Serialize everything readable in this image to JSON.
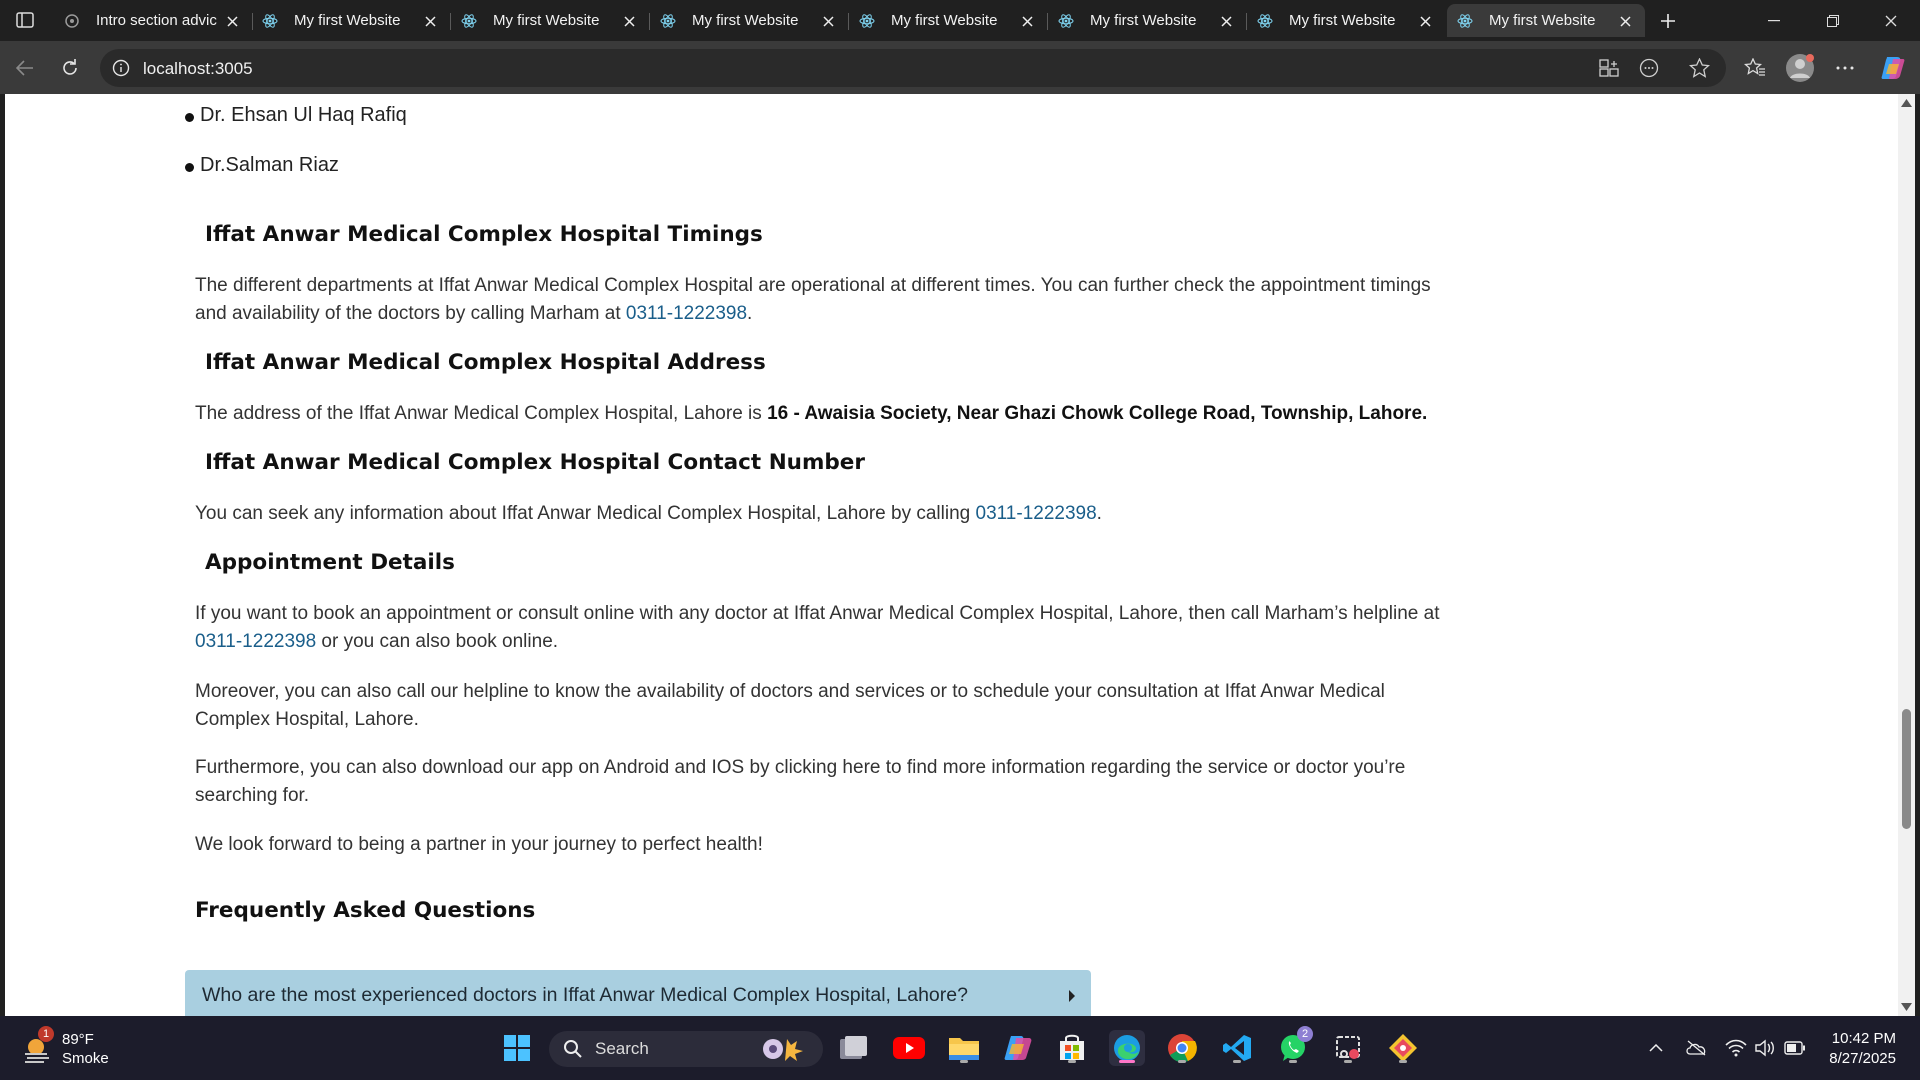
{
  "browser": {
    "tabs": [
      {
        "title": "Intro section advic",
        "active": false
      },
      {
        "title": "My first Website",
        "active": false
      },
      {
        "title": "My first Website",
        "active": false
      },
      {
        "title": "My first Website",
        "active": false
      },
      {
        "title": "My first Website",
        "active": false
      },
      {
        "title": "My first Website",
        "active": false
      },
      {
        "title": "My first Website",
        "active": false
      },
      {
        "title": "My first Website",
        "active": true
      }
    ],
    "url": "localhost:3005"
  },
  "page": {
    "doctors": [
      "Dr. Ehsan Ul Haq Rafiq",
      "Dr.Salman Riaz"
    ],
    "timings": {
      "heading": "Iffat Anwar Medical Complex Hospital Timings",
      "text": "The different departments at Iffat Anwar Medical Complex Hospital are operational at different times. You can further check the appointment timings and availability of the doctors by calling Marham at ",
      "phone": "0311-1222398",
      "end": "."
    },
    "address": {
      "heading": "Iffat Anwar Medical Complex Hospital Address",
      "text": "The address of the Iffat Anwar Medical Complex Hospital, Lahore is ",
      "value": "16 - Awaisia Society, Near Ghazi Chowk College Road, Township, Lahore."
    },
    "contact": {
      "heading": "Iffat Anwar Medical Complex Hospital Contact Number",
      "text": "You can seek any information about Iffat Anwar Medical Complex Hospital, Lahore by calling ",
      "phone": "0311-1222398",
      "end": "."
    },
    "appointment": {
      "heading": "Appointment Details",
      "p1_text": "If you want to book an appointment or consult online with any doctor at Iffat Anwar Medical Complex Hospital, Lahore, then call Marham’s helpline at ",
      "p1_phone": "0311-1222398",
      "p1_end": " or you can also book online.",
      "p2": "Moreover, you can also call our helpline to know the availability of doctors and services or to schedule your consultation at Iffat Anwar Medical Complex Hospital, Lahore.",
      "p3": "Furthermore, you can also download our app on Android and IOS by clicking here to find more information regarding the service or doctor you’re searching for.",
      "p4": "We look forward to being a partner in your journey to perfect health!"
    },
    "faq": {
      "title": "Frequently Asked Questions",
      "items": [
        "Who are the most experienced doctors in Iffat Anwar Medical Complex Hospital, Lahore?"
      ]
    }
  },
  "taskbar": {
    "weather": {
      "temp": "89°F",
      "condition": "Smoke",
      "badge": "1"
    },
    "search_label": "Search",
    "whatsapp_badge": "2",
    "time": "10:42 PM",
    "date": "8/27/2025"
  },
  "colors": {
    "link": "#1a5e8a",
    "faq_bg": "#a9cfe0",
    "browser_chrome": "#202020"
  }
}
